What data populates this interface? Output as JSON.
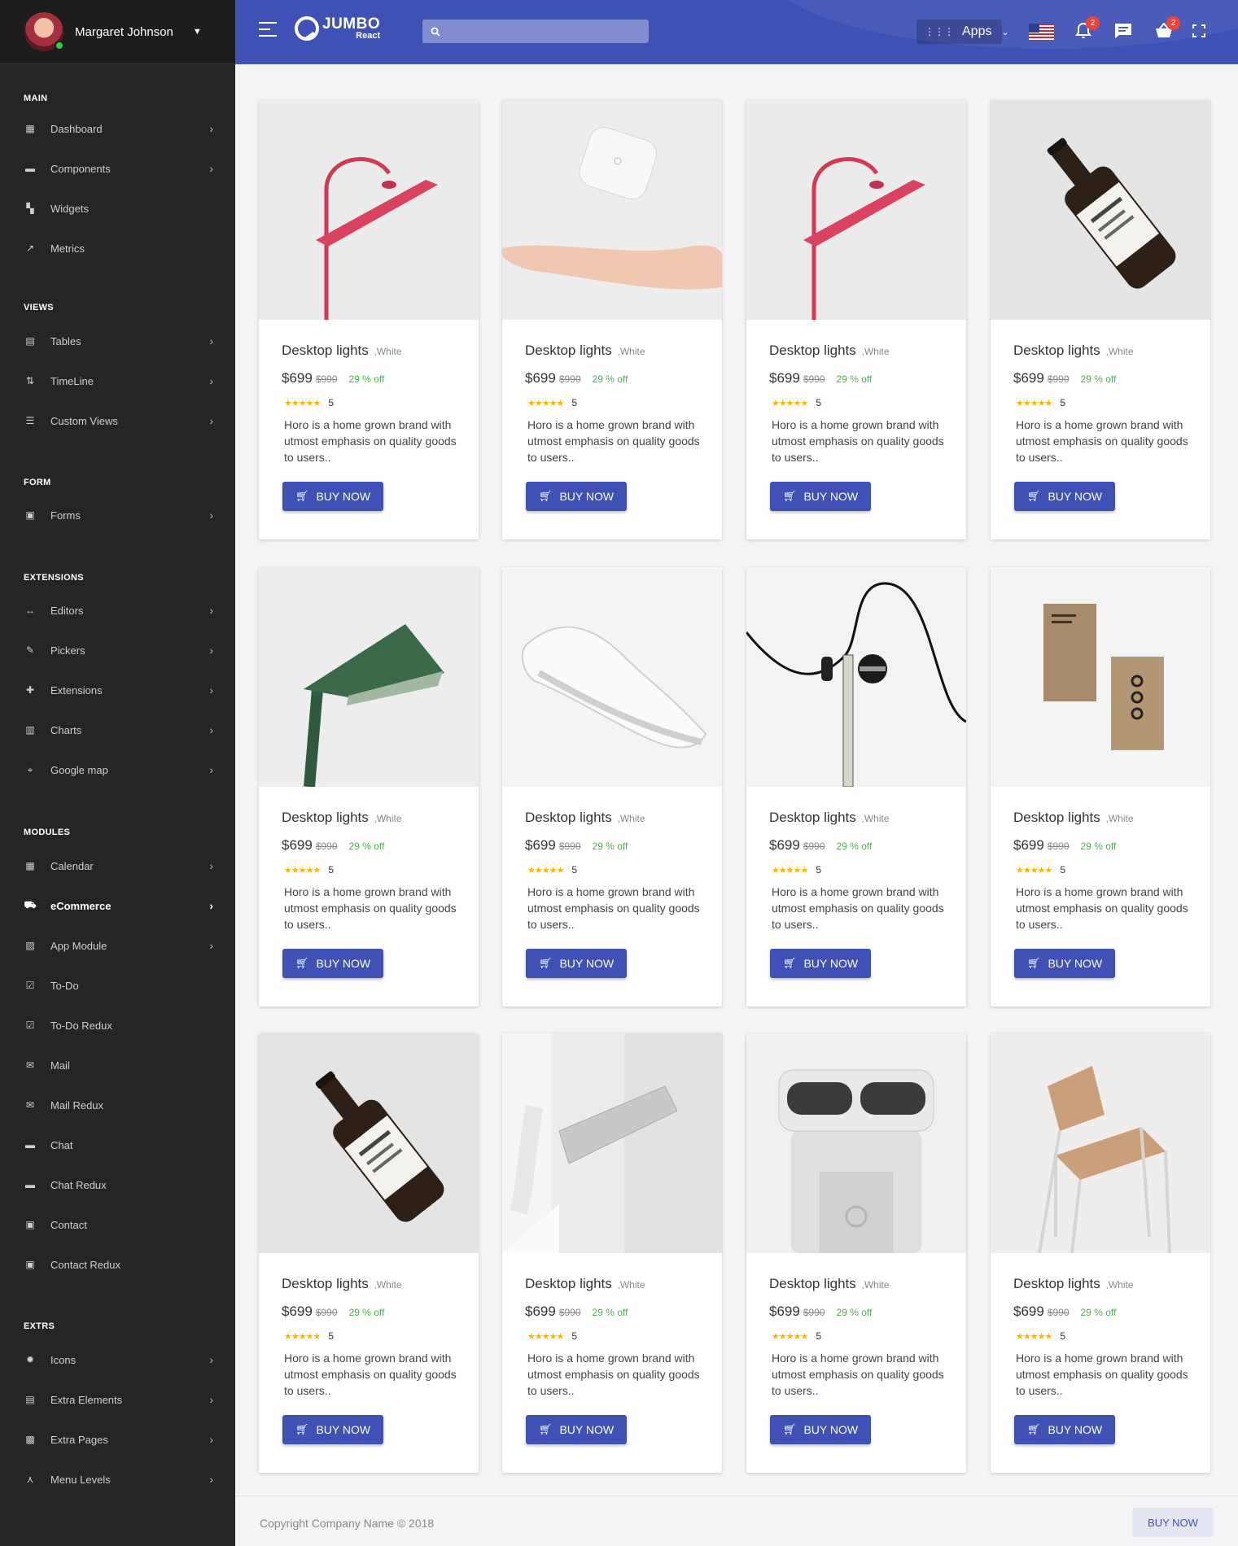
{
  "user": {
    "name": "Margaret Johnson"
  },
  "brand": {
    "name": "JUMBO",
    "sub": "React"
  },
  "search": {
    "placeholder": ""
  },
  "apps_label": "Apps",
  "notifications_count": "2",
  "cart_count": "2",
  "sidebar": {
    "sections": [
      {
        "header": "MAIN",
        "items": [
          {
            "label": "Dashboard",
            "icon": "dashboard-icon",
            "chevron": true
          },
          {
            "label": "Components",
            "icon": "folder-icon",
            "chevron": true
          },
          {
            "label": "Widgets",
            "icon": "widgets-icon",
            "chevron": false
          },
          {
            "label": "Metrics",
            "icon": "trending-up-icon",
            "chevron": false
          }
        ]
      },
      {
        "header": "VIEWS",
        "items": [
          {
            "label": "Tables",
            "icon": "table-icon",
            "chevron": true
          },
          {
            "label": "TimeLine",
            "icon": "timeline-icon",
            "chevron": true
          },
          {
            "label": "Custom Views",
            "icon": "list-icon",
            "chevron": true
          }
        ]
      },
      {
        "header": "FORM",
        "items": [
          {
            "label": "Forms",
            "icon": "form-icon",
            "chevron": true
          }
        ]
      },
      {
        "header": "EXTENSIONS",
        "items": [
          {
            "label": "Editors",
            "icon": "code-icon",
            "chevron": true
          },
          {
            "label": "Pickers",
            "icon": "brush-icon",
            "chevron": true
          },
          {
            "label": "Extensions",
            "icon": "puzzle-icon",
            "chevron": true
          },
          {
            "label": "Charts",
            "icon": "chart-icon",
            "chevron": true
          },
          {
            "label": "Google map",
            "icon": "map-icon",
            "chevron": true
          }
        ]
      },
      {
        "header": "MODULES",
        "items": [
          {
            "label": "Calendar",
            "icon": "calendar-icon",
            "chevron": true
          },
          {
            "label": "eCommerce",
            "icon": "cart-icon",
            "chevron": true,
            "active": true
          },
          {
            "label": "App Module",
            "icon": "app-module-icon",
            "chevron": true
          },
          {
            "label": "To-Do",
            "icon": "checkbox-icon",
            "chevron": false
          },
          {
            "label": "To-Do Redux",
            "icon": "checkbox-icon",
            "chevron": false
          },
          {
            "label": "Mail",
            "icon": "mail-icon",
            "chevron": false
          },
          {
            "label": "Mail Redux",
            "icon": "mail-icon",
            "chevron": false
          },
          {
            "label": "Chat",
            "icon": "chat-icon",
            "chevron": false
          },
          {
            "label": "Chat Redux",
            "icon": "chat-icon",
            "chevron": false
          },
          {
            "label": "Contact",
            "icon": "contact-icon",
            "chevron": false
          },
          {
            "label": "Contact Redux",
            "icon": "contact-icon",
            "chevron": false
          }
        ]
      },
      {
        "header": "EXTRS",
        "items": [
          {
            "label": "Icons",
            "icon": "bug-icon",
            "chevron": true
          },
          {
            "label": "Extra Elements",
            "icon": "elements-icon",
            "chevron": true
          },
          {
            "label": "Extra Pages",
            "icon": "pages-icon",
            "chevron": true
          },
          {
            "label": "Menu Levels",
            "icon": "menu-levels-icon",
            "chevron": true
          }
        ]
      }
    ]
  },
  "products": [
    {
      "image": "red-lamp",
      "name": "Desktop lights",
      "variant": ",White",
      "price": "$699",
      "old_price": "$990",
      "discount": "29 % off",
      "rating": "5",
      "description": "Horo is a home grown brand with utmost emphasis on quality goods to users..",
      "button": "BUY NOW"
    },
    {
      "image": "hand-device",
      "name": "Desktop lights",
      "variant": ",White",
      "price": "$699",
      "old_price": "$990",
      "discount": "29 % off",
      "rating": "5",
      "description": "Horo is a home grown brand with utmost emphasis on quality goods to users..",
      "button": "BUY NOW"
    },
    {
      "image": "red-lamp",
      "name": "Desktop lights",
      "variant": ",White",
      "price": "$699",
      "old_price": "$990",
      "discount": "29 % off",
      "rating": "5",
      "description": "Horo is a home grown brand with utmost emphasis on quality goods to users..",
      "button": "BUY NOW"
    },
    {
      "image": "bottle",
      "name": "Desktop lights",
      "variant": ",White",
      "price": "$699",
      "old_price": "$990",
      "discount": "29 % off",
      "rating": "5",
      "description": "Horo is a home grown brand with utmost emphasis on quality goods to users..",
      "button": "BUY NOW"
    },
    {
      "image": "green-lamp",
      "name": "Desktop lights",
      "variant": ",White",
      "price": "$699",
      "old_price": "$990",
      "discount": "29 % off",
      "rating": "5",
      "description": "Horo is a home grown brand with utmost emphasis on quality goods to users..",
      "button": "BUY NOW"
    },
    {
      "image": "sneaker",
      "name": "Desktop lights",
      "variant": ",White",
      "price": "$699",
      "old_price": "$990",
      "discount": "29 % off",
      "rating": "5",
      "description": "Horo is a home grown brand with utmost emphasis on quality goods to users..",
      "button": "BUY NOW"
    },
    {
      "image": "earphone",
      "name": "Desktop lights",
      "variant": ",White",
      "price": "$699",
      "old_price": "$990",
      "discount": "29 % off",
      "rating": "5",
      "description": "Horo is a home grown brand with utmost emphasis on quality goods to users..",
      "button": "BUY NOW"
    },
    {
      "image": "business-cards",
      "name": "Desktop lights",
      "variant": ",White",
      "price": "$699",
      "old_price": "$990",
      "discount": "29 % off",
      "rating": "5",
      "description": "Horo is a home grown brand with utmost emphasis on quality goods to users..",
      "button": "BUY NOW"
    },
    {
      "image": "bottle",
      "name": "Desktop lights",
      "variant": ",White",
      "price": "$699",
      "old_price": "$990",
      "discount": "29 % off",
      "rating": "5",
      "description": "Horo is a home grown brand with utmost emphasis on quality goods to users..",
      "button": "BUY NOW"
    },
    {
      "image": "wall-lamp",
      "name": "Desktop lights",
      "variant": ",White",
      "price": "$699",
      "old_price": "$990",
      "discount": "29 % off",
      "rating": "5",
      "description": "Horo is a home grown brand with utmost emphasis on quality goods to users..",
      "button": "BUY NOW"
    },
    {
      "image": "shaver",
      "name": "Desktop lights",
      "variant": ",White",
      "price": "$699",
      "old_price": "$990",
      "discount": "29 % off",
      "rating": "5",
      "description": "Horo is a home grown brand with utmost emphasis on quality goods to users..",
      "button": "BUY NOW"
    },
    {
      "image": "chair",
      "name": "Desktop lights",
      "variant": ",White",
      "price": "$699",
      "old_price": "$990",
      "discount": "29 % off",
      "rating": "5",
      "description": "Horo is a home grown brand with utmost emphasis on quality goods to users..",
      "button": "BUY NOW"
    }
  ],
  "footer": {
    "copyright": "Copyright Company Name © 2018",
    "button": "BUY NOW"
  },
  "colors": {
    "primary": "#3f51b5",
    "sidebar": "#252525",
    "discount": "#4caf50",
    "star": "#ffb300",
    "badge": "#f44336"
  }
}
